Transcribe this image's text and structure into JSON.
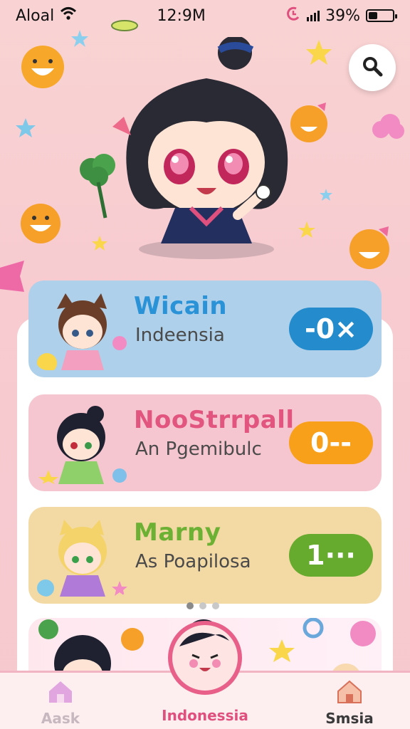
{
  "status_bar": {
    "carrier": "Aloal",
    "time": "12:9M",
    "battery_percent_label": "39%",
    "battery_level": 0.39
  },
  "search": {
    "icon": "search-icon"
  },
  "cards": [
    {
      "name": "Wicain",
      "subtitle": "Indeensia",
      "badge": "-0×",
      "bg": "#aed0ea",
      "name_color": "#2a93d8",
      "badge_color": "#248ccd"
    },
    {
      "name": "NooStrrpall",
      "subtitle": "An Pgemibulc",
      "badge": "0--",
      "bg": "#f6c6d0",
      "name_color": "#e2557f",
      "badge_color": "#f8a019"
    },
    {
      "name": "Marny",
      "subtitle": "As Poapilosa",
      "badge": "1···",
      "bg": "#f3d9a4",
      "name_color": "#6cb034",
      "badge_color": "#66aa2e"
    }
  ],
  "pagination": {
    "count": 3,
    "active": 0
  },
  "nav": {
    "items": [
      {
        "label": "Aask",
        "icon": "home-icon",
        "color": "#c7b8c0"
      },
      {
        "label": "Indonessia",
        "icon": "face-icon",
        "color": "#e0507e"
      },
      {
        "label": "Smsia",
        "icon": "home-icon",
        "color": "#3a3a3a"
      }
    ]
  }
}
